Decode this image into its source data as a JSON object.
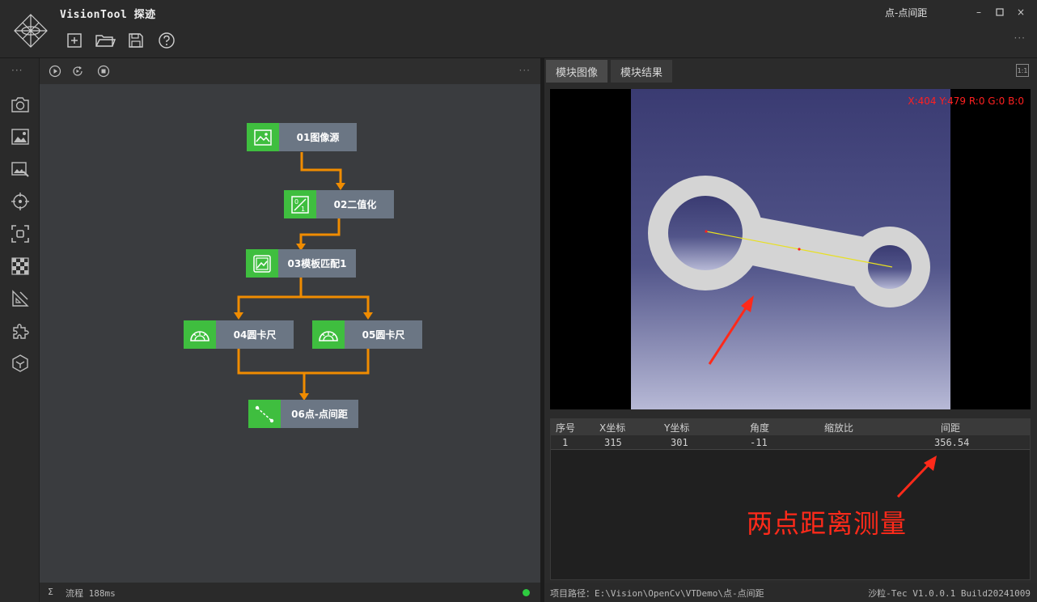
{
  "app": {
    "title": "VisionTool 探迹",
    "project_name": "点-点间距",
    "more": "···"
  },
  "toolbar": [
    "new-icon",
    "open-icon",
    "save-icon",
    "help-icon"
  ],
  "window_controls": [
    "minimize",
    "maximize",
    "close"
  ],
  "iconbar": {
    "more": "···",
    "tools": [
      "camera-icon",
      "image-source-icon",
      "image-edit-icon",
      "target-locate-icon",
      "focus-frame-icon",
      "checker-icon",
      "ruler-triangle-icon",
      "puzzle-icon",
      "cube-icon"
    ]
  },
  "flow": {
    "controls": [
      "run-once-icon",
      "run-loop-icon",
      "stop-icon"
    ],
    "more": "···",
    "nodes": [
      {
        "id": "01",
        "label": "01图像源",
        "icon": "image-icon"
      },
      {
        "id": "02",
        "label": "02二值化",
        "icon": "binarize-icon"
      },
      {
        "id": "03",
        "label": "03模板匹配1",
        "icon": "template-match-icon"
      },
      {
        "id": "04",
        "label": "04圆卡尺",
        "icon": "caliper-icon"
      },
      {
        "id": "05",
        "label": "05圆卡尺",
        "icon": "caliper-icon"
      },
      {
        "id": "06",
        "label": "06点-点间距",
        "icon": "distance-icon"
      }
    ],
    "status": {
      "sigma": "Σ",
      "time": "流程 188ms",
      "ok_color": "#2ecc40"
    }
  },
  "tabs": {
    "image": "模块图像",
    "result": "模块结果",
    "fit": "1:1"
  },
  "viewer": {
    "pixel_readout": "X:404 Y:479  R:0 G:0 B:0"
  },
  "result_table": {
    "headers": [
      "序号",
      "X坐标",
      "Y坐标",
      "角度",
      "缩放比",
      "间距"
    ],
    "rows": [
      [
        "1",
        "315",
        "301",
        "-11",
        "",
        "356.54"
      ]
    ]
  },
  "annotation": {
    "text": "两点距离测量",
    "color": "#ff2a1a"
  },
  "statusbar": {
    "project_path": "项目路径：E:\\Vision\\OpenCv\\VTDemo\\点-点间距",
    "version": "沙粒-Tec V1.0.0.1 Build20241009"
  }
}
